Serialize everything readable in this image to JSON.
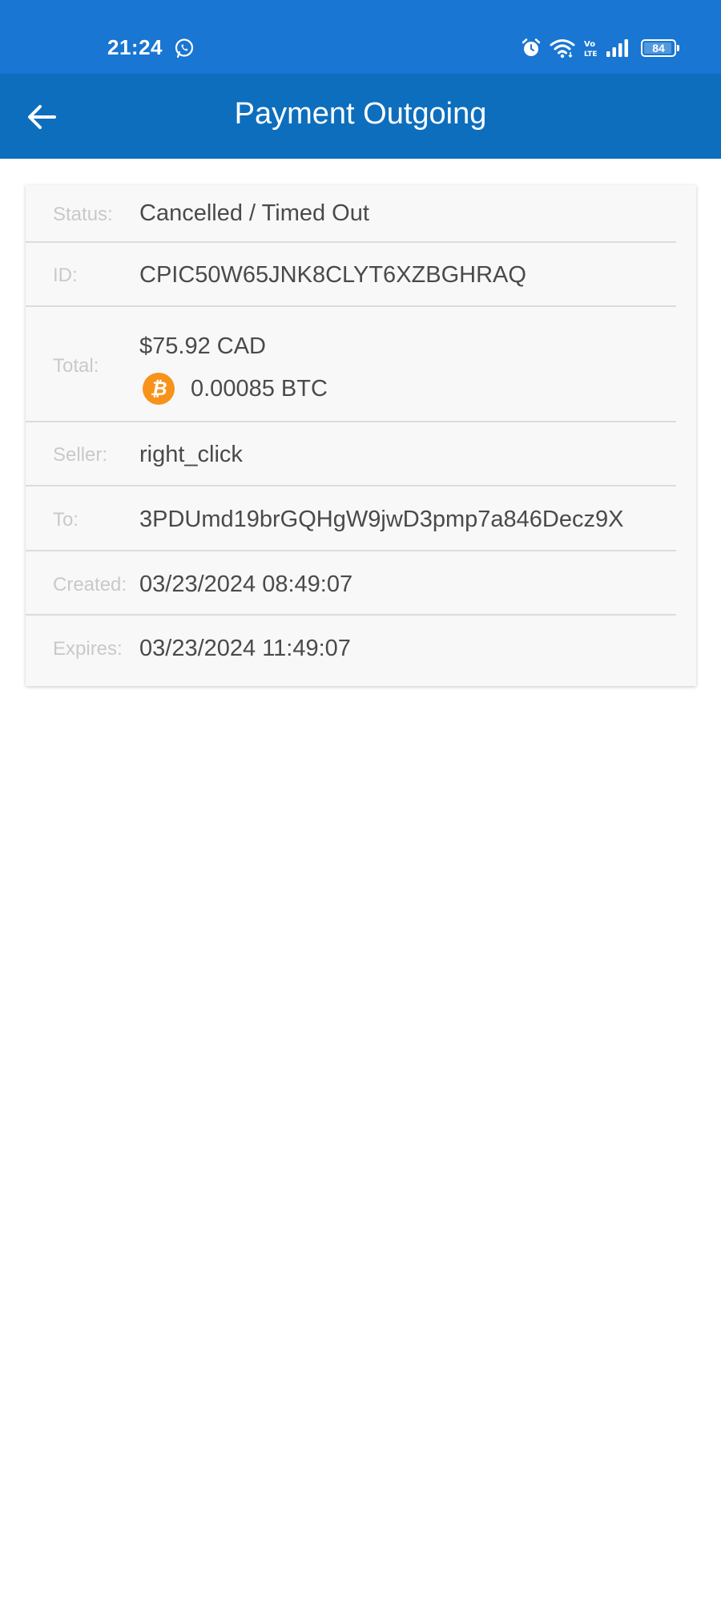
{
  "status_bar": {
    "time": "21:24",
    "battery": "84",
    "icons": [
      "whatsapp-icon",
      "alarm-icon",
      "wifi-icon",
      "volte-icon",
      "signal-icon",
      "battery-icon"
    ]
  },
  "app_bar": {
    "title": "Payment Outgoing",
    "back_icon": "arrow-left-icon"
  },
  "details": {
    "status_label": "Status:",
    "status_value": "Cancelled / Timed Out",
    "id_label": "ID:",
    "id_value": "CPIC50W65JNK8CLYT6XZBGHRAQ",
    "total_label": "Total:",
    "total_fiat_amount": "$75.92",
    "total_fiat_currency": "CAD",
    "total_crypto_amount": "0.00085",
    "total_crypto_currency": "BTC",
    "crypto_icon": "bitcoin-icon",
    "seller_label": "Seller:",
    "seller_value": "right_click",
    "to_label": "To:",
    "to_value": "3PDUmd19brGQHgW9jwD3pmp7a846Decz9X",
    "created_label": "Created:",
    "created_value": "03/23/2024 08:49:07",
    "expires_label": "Expires:",
    "expires_value": "03/23/2024 11:49:07"
  },
  "colors": {
    "status_bar": "#1976d2",
    "app_bar": "#0d6ebd",
    "bitcoin": "#f7931a"
  }
}
